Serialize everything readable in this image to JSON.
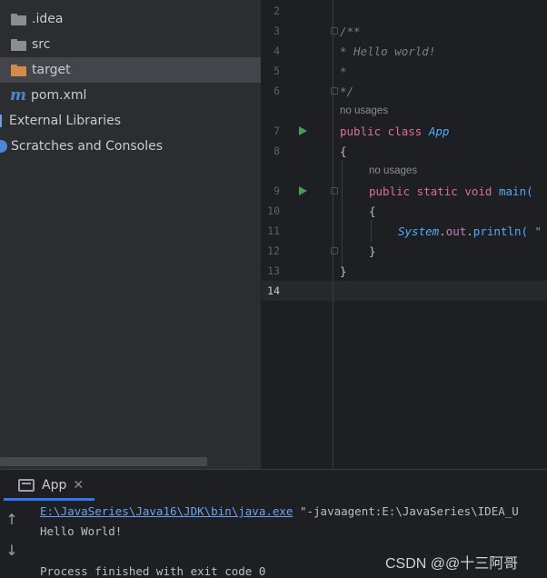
{
  "project_tree": {
    "items": [
      {
        "label": ".idea",
        "icon": "folder-icon"
      },
      {
        "label": "src",
        "icon": "folder-icon"
      },
      {
        "label": "target",
        "icon": "folder-orange-icon",
        "selected": true
      },
      {
        "label": "pom.xml",
        "icon": "maven-icon"
      },
      {
        "label": "External Libraries",
        "icon": "library-icon"
      },
      {
        "label": "Scratches and Consoles",
        "icon": "scratch-icon"
      }
    ]
  },
  "editor": {
    "current_line": "14",
    "lines": [
      {
        "num": "2",
        "code": ""
      },
      {
        "num": "3",
        "code": "/**"
      },
      {
        "num": "4",
        "code": " * Hello world!"
      },
      {
        "num": "5",
        "code": " *"
      },
      {
        "num": "6",
        "code": " */"
      },
      {
        "num": "7",
        "hint": "no usages",
        "kw": "public class",
        "name": "App"
      },
      {
        "num": "8",
        "code": "{"
      },
      {
        "num": "9",
        "hint": "no usages",
        "kw": "public static void",
        "name": "main("
      },
      {
        "num": "10",
        "code": "{"
      },
      {
        "num": "11",
        "cls": "System",
        "dot1": ".",
        "field": "out",
        "dot2": ".",
        "method": "println(",
        "str": " \""
      },
      {
        "num": "12",
        "code": "}"
      },
      {
        "num": "13",
        "code": "}"
      },
      {
        "num": "14",
        "code": ""
      }
    ]
  },
  "run_window": {
    "tab_label": "App",
    "close_symbol": "✕",
    "up_symbol": "↑",
    "down_symbol": "↓",
    "console": {
      "command_path": "E:\\JavaSeries\\Java16\\JDK\\bin\\java.exe",
      "command_args": " \"-javaagent:E:\\JavaSeries\\IDEA_U",
      "output": "Hello World!",
      "exit": "Process finished with exit code 0"
    }
  },
  "watermark": "CSDN @@十三阿哥",
  "colors": {
    "background": "#1e1f22",
    "panel": "#2b2d30",
    "selection": "#43454a",
    "keyword": "#cf8e6d",
    "link": "#6aa2f0",
    "run": "#499c54",
    "accent": "#3574f0"
  }
}
